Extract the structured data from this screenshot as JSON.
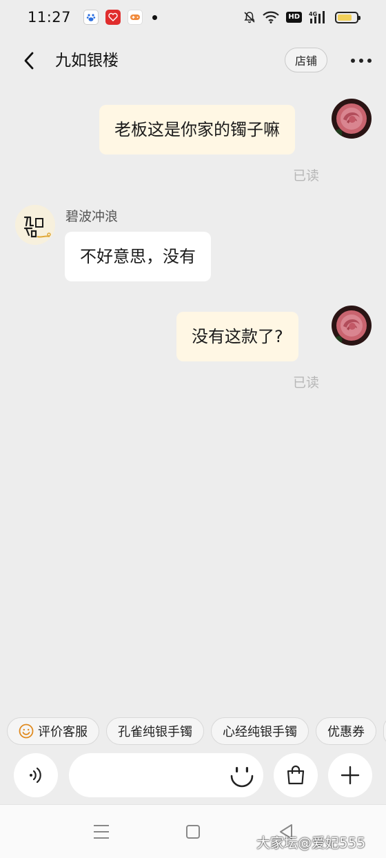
{
  "status_bar": {
    "time": "11:27",
    "hd_label": "HD",
    "network": "4G"
  },
  "header": {
    "title": "九如银楼",
    "store_button": "店铺"
  },
  "messages": [
    {
      "side": "mine",
      "text": "老板这是你家的镯子嘛",
      "read": "已读"
    },
    {
      "side": "theirs",
      "sender": "碧波冲浪",
      "text": "不好意思，没有"
    },
    {
      "side": "mine",
      "text": "没有这款了?",
      "read": "已读"
    }
  ],
  "quick_replies": [
    "评价客服",
    "孔雀纯银手镯",
    "心经纯银手镯",
    "优惠券"
  ],
  "input": {
    "value": "",
    "placeholder": ""
  },
  "watermark": "大家坛@爱妃555",
  "colors": {
    "mine_bubble": "#fff7e4",
    "theirs_bubble": "#ffffff",
    "background": "#ededed",
    "read_text": "#b7b7b7"
  }
}
